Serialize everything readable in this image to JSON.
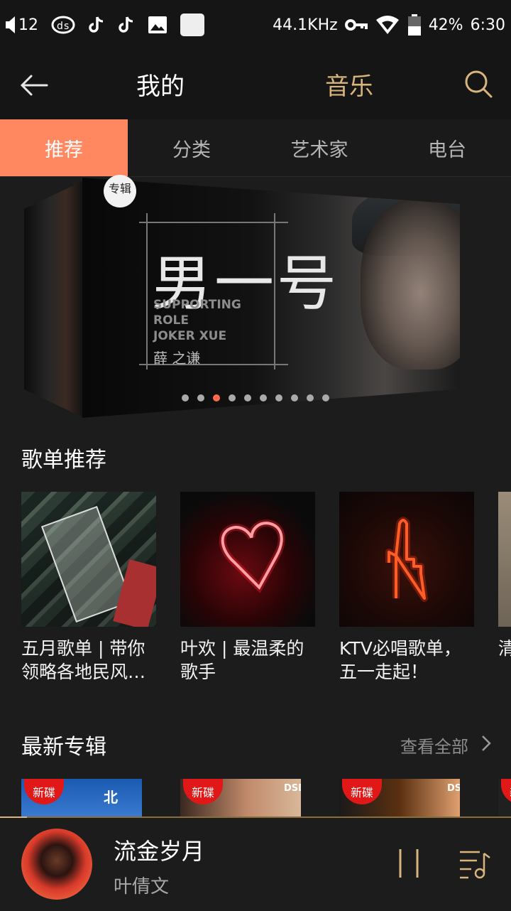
{
  "status_bar": {
    "volume": "12",
    "sample_rate": "44.1KHz",
    "battery": "42%",
    "time": "6:30"
  },
  "header": {
    "mine": "我的",
    "music": "音乐"
  },
  "tabs": [
    {
      "label": "推荐",
      "active": true
    },
    {
      "label": "分类",
      "active": false
    },
    {
      "label": "艺术家",
      "active": false
    },
    {
      "label": "电台",
      "active": false
    }
  ],
  "banner": {
    "badge": "专辑",
    "title": "男一号",
    "subtitle": "SUPPORTING\nROLE\nJOKER XUE",
    "artist": "薛 之谦",
    "dot_count": 10,
    "active_dot": 2
  },
  "playlists": {
    "title": "歌单推荐",
    "items": [
      {
        "title": "五月歌单 | 带你领略各地民风…"
      },
      {
        "title": "叶欢 | 最温柔的歌手"
      },
      {
        "title": "KTV必唱歌单，五一走起！"
      },
      {
        "title": "清意"
      }
    ]
  },
  "new_albums": {
    "title": "最新专辑",
    "view_all": "查看全部",
    "tag": "新碟",
    "labels": [
      "北",
      "DSD",
      "DSD"
    ]
  },
  "player": {
    "title": "流金岁月",
    "artist": "叶倩文"
  },
  "colors": {
    "accent_tab": "#ff8860",
    "gold": "#d8b57c",
    "background": "#1c1c1c"
  }
}
